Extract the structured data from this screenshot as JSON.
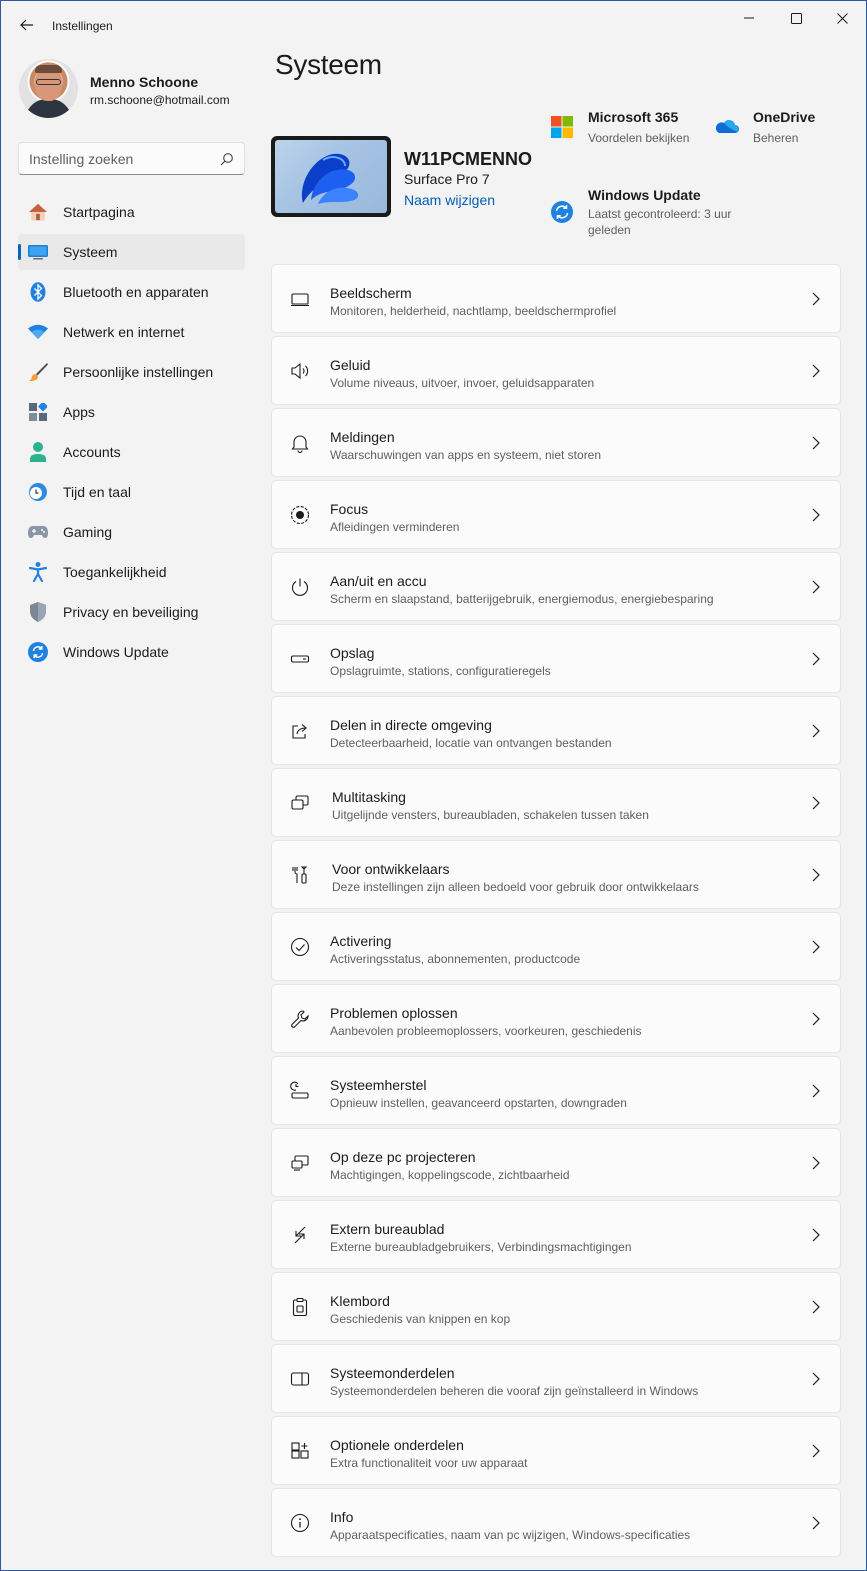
{
  "window": {
    "title": "Instellingen"
  },
  "profile": {
    "name": "Menno Schoone",
    "email": "rm.schoone@hotmail.com"
  },
  "search": {
    "placeholder": "Instelling zoeken"
  },
  "nav": {
    "items": [
      {
        "label": "Startpagina",
        "icon": "home-icon"
      },
      {
        "label": "Systeem",
        "icon": "system-icon",
        "active": true
      },
      {
        "label": "Bluetooth en apparaten",
        "icon": "bluetooth-icon"
      },
      {
        "label": "Netwerk en internet",
        "icon": "wifi-icon"
      },
      {
        "label": "Persoonlijke instellingen",
        "icon": "brush-icon"
      },
      {
        "label": "Apps",
        "icon": "apps-icon"
      },
      {
        "label": "Accounts",
        "icon": "accounts-icon"
      },
      {
        "label": "Tijd en taal",
        "icon": "time-language-icon"
      },
      {
        "label": "Gaming",
        "icon": "gamepad-icon"
      },
      {
        "label": "Toegankelijkheid",
        "icon": "accessibility-icon"
      },
      {
        "label": "Privacy en beveiliging",
        "icon": "shield-icon"
      },
      {
        "label": "Windows Update",
        "icon": "windows-update-icon"
      }
    ]
  },
  "main": {
    "title": "Systeem",
    "device": {
      "name": "W11PCMENNO",
      "model": "Surface Pro 7",
      "rename_link": "Naam wijzigen"
    },
    "quick": {
      "microsoft365": {
        "title": "Microsoft 365",
        "subtitle": "Voordelen bekijken"
      },
      "onedrive": {
        "title": "OneDrive",
        "subtitle": "Beheren"
      },
      "windows_update": {
        "title": "Windows Update",
        "subtitle": "Laatst gecontroleerd: 3 uur geleden"
      }
    },
    "cards": [
      {
        "title": "Beeldscherm",
        "subtitle": "Monitoren, helderheid, nachtlamp, beeldschermprofiel",
        "icon": "display-icon"
      },
      {
        "title": "Geluid",
        "subtitle": "Volume niveaus, uitvoer, invoer, geluidsapparaten",
        "icon": "speaker-icon"
      },
      {
        "title": "Meldingen",
        "subtitle": "Waarschuwingen van apps en systeem, niet storen",
        "icon": "bell-icon"
      },
      {
        "title": "Focus",
        "subtitle": "Afleidingen verminderen",
        "icon": "focus-icon"
      },
      {
        "title": "Aan/uit en accu",
        "subtitle": "Scherm en slaapstand, batterijgebruik, energiemodus, energiebesparing",
        "icon": "power-icon"
      },
      {
        "title": "Opslag",
        "subtitle": "Opslagruimte, stations, configuratieregels",
        "icon": "storage-icon"
      },
      {
        "title": "Delen in directe omgeving",
        "subtitle": "Detecteerbaarheid, locatie van ontvangen bestanden",
        "icon": "share-icon"
      },
      {
        "title": "Multitasking",
        "subtitle": "Uitgelijnde vensters, bureaubladen, schakelen tussen taken",
        "icon": "multitasking-icon"
      },
      {
        "title": "Voor ontwikkelaars",
        "subtitle": "Deze instellingen zijn alleen bedoeld voor gebruik door ontwikkelaars",
        "icon": "developer-tools-icon"
      },
      {
        "title": "Activering",
        "subtitle": "Activeringsstatus, abonnementen, productcode",
        "icon": "check-circle-icon"
      },
      {
        "title": "Problemen oplossen",
        "subtitle": "Aanbevolen probleemoplossers, voorkeuren, geschiedenis",
        "icon": "wrench-icon"
      },
      {
        "title": "Systeemherstel",
        "subtitle": "Opnieuw instellen, geavanceerd opstarten, downgraden",
        "icon": "recovery-icon"
      },
      {
        "title": "Op deze pc projecteren",
        "subtitle": "Machtigingen, koppelingscode, zichtbaarheid",
        "icon": "project-icon"
      },
      {
        "title": "Extern bureaublad",
        "subtitle": "Externe bureaubladgebruikers, Verbindingsmachtigingen",
        "icon": "remote-desktop-icon"
      },
      {
        "title": "Klembord",
        "subtitle": "Geschiedenis van knippen en kop",
        "icon": "clipboard-icon"
      },
      {
        "title": "Systeemonderdelen",
        "subtitle": "Systeemonderdelen beheren die vooraf zijn geïnstalleerd in Windows",
        "icon": "system-components-icon"
      },
      {
        "title": "Optionele onderdelen",
        "subtitle": "Extra functionaliteit voor uw apparaat",
        "icon": "optional-features-icon"
      },
      {
        "title": "Info",
        "subtitle": "Apparaatspecificaties, naam van pc wijzigen, Windows-specificaties",
        "icon": "info-icon"
      }
    ]
  },
  "colors": {
    "accent": "#0067c0",
    "link": "#005fb8",
    "background": "#f3f3f3",
    "card": "#fbfbfb"
  }
}
